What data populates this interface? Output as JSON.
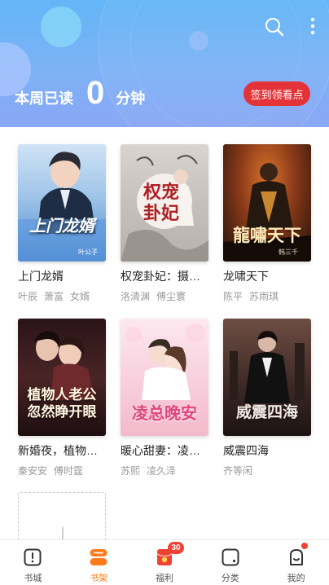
{
  "header": {
    "reading_prefix": "本周已读",
    "reading_minutes": "0",
    "reading_unit": "分钟",
    "signin_label": "签到领看点",
    "icons": [
      "search-icon",
      "more-vertical-icon"
    ],
    "colors": {
      "gradient_top": "#63b6f7",
      "gradient_bottom": "#8aa7f5",
      "signin_bg": "#e43338"
    }
  },
  "books": [
    {
      "title": "上门龙婿",
      "cover_text": "上门龙婿",
      "cover_author": "叶公子",
      "authors": [
        "叶辰",
        "萧富",
        "女婿"
      ]
    },
    {
      "title": "权宠卦妃：摄…",
      "cover_text": "权宠卦妃",
      "cover_author": "",
      "authors": [
        "洛清渊",
        "傅尘寰"
      ]
    },
    {
      "title": "龙啸天下",
      "cover_text": "龍嘯天下",
      "cover_author": "韩三千",
      "authors": [
        "陈平",
        "苏雨琪"
      ]
    },
    {
      "title": "新婚夜，植物…",
      "cover_text": "植物人老公忽然睁开眼",
      "cover_author": "",
      "authors": [
        "秦安安",
        "傅时霆"
      ]
    },
    {
      "title": "暖心甜妻：凌…",
      "cover_text": "凌总晚安",
      "cover_author": "",
      "authors": [
        "苏熙",
        "凌久泽"
      ]
    },
    {
      "title": "威震四海",
      "cover_text": "威震四海",
      "cover_author": "",
      "authors": [
        "齐等闲"
      ]
    }
  ],
  "nav": {
    "items": [
      {
        "label": "书城",
        "icon": "bookstore-icon"
      },
      {
        "label": "书架",
        "icon": "bookshelf-icon"
      },
      {
        "label": "福利",
        "icon": "gift-envelope-icon"
      },
      {
        "label": "分类",
        "icon": "category-icon"
      },
      {
        "label": "我的",
        "icon": "profile-icon"
      }
    ],
    "active": "书架",
    "welfare_badge": "30",
    "accent_color": "#ff7a1a"
  }
}
